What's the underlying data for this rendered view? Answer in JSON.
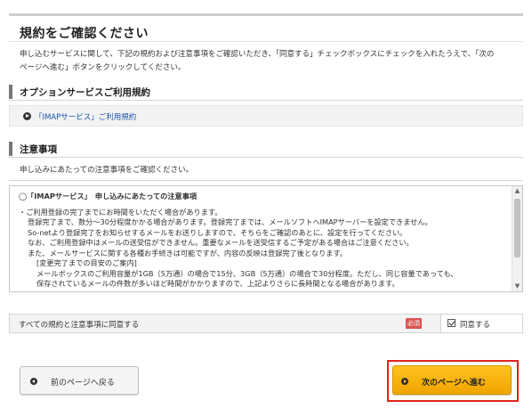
{
  "page": {
    "title": "規約をご確認ください",
    "intro_line1": "申し込むサービスに関して、下記の規約および注意事項をご確認いただき、「同意する」チェックボックスにチェックを入れたうえで、「次の",
    "intro_line2": "ページへ進む」ボタンをクリックしてください。"
  },
  "option_section": {
    "heading": "オプションサービスご利用規約",
    "link_label": "「IMAPサービス」ご利用規約"
  },
  "notice_section": {
    "heading": "注意事項",
    "intro": "申し込みにあたっての注意事項をご確認ください。",
    "box": {
      "heading": "◯「IMAPサービス」　申し込みにあたっての注意事項",
      "lines": [
        "・ご利用登録の完了までにお時間をいただく場合があります。",
        "登録完了まで、数分～30分程度かかる場合があります。登録完了までは、メールソフトへIMAPサーバーを設定できません。",
        "So-netより登録完了をお知らせするメールをお送りしますので、そちらをご確認のあとに、設定を行ってください。",
        "なお、ご利用登録中はメールの送受信ができません。重要なメールを送受信するご予定がある場合はご注意ください。",
        "また、メールサービスに関する各種お手続きは可能ですが、内容の反映は登録完了後となります。",
        "[変更完了までの目安のご案内]",
        "メールボックスのご利用容量が1GB（5万通）の場合で15分、3GB（5万通）の場合で30分程度。ただし、同じ容量であっても、",
        "保存されているメールの件数が多いほど時間がかかりますので、上記よりさらに長時間となる場合があります。"
      ]
    }
  },
  "agreement": {
    "label": "すべての規約と注意事項に同意する",
    "required_badge": "必須",
    "checkbox_label": "同意する",
    "checked": true
  },
  "buttons": {
    "back": "前のページへ戻る",
    "next": "次のページへ進む"
  },
  "colors": {
    "accent": "#f5b000",
    "highlight": "#e0231b",
    "link": "#1a56b0",
    "required": "#d9534f"
  }
}
